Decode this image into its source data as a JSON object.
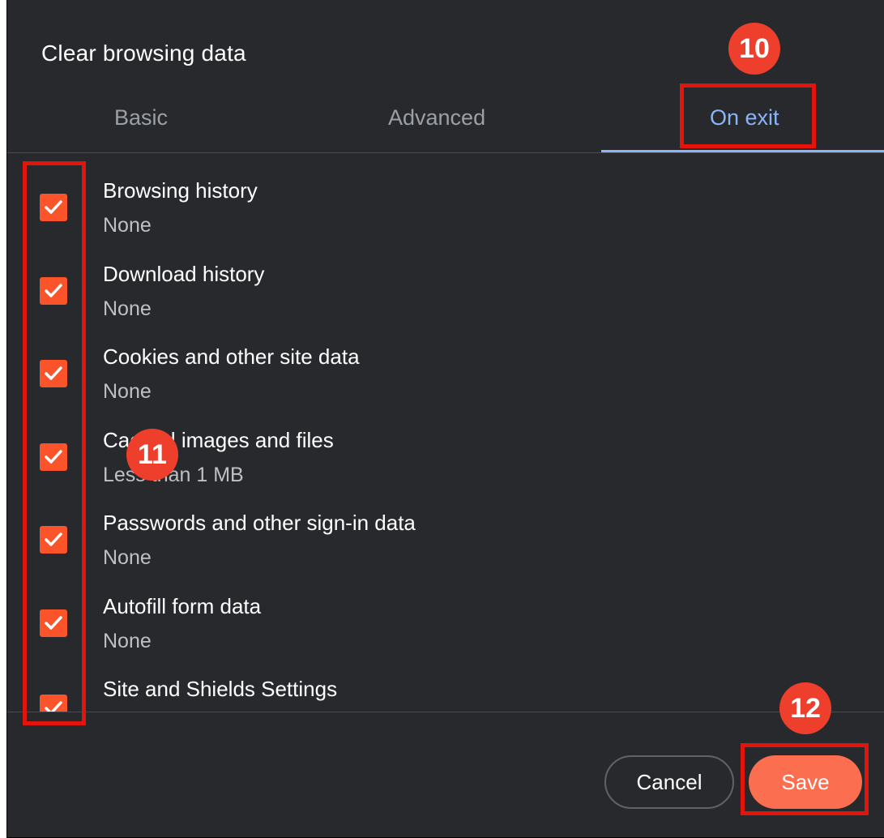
{
  "dialog": {
    "title": "Clear browsing data"
  },
  "tabs": [
    {
      "label": "Basic"
    },
    {
      "label": "Advanced"
    },
    {
      "label": "On exit"
    }
  ],
  "items": [
    {
      "title": "Browsing history",
      "subtitle": "None",
      "checked": true
    },
    {
      "title": "Download history",
      "subtitle": "None",
      "checked": true
    },
    {
      "title": "Cookies and other site data",
      "subtitle": "None",
      "checked": true
    },
    {
      "title": "Cached images and files",
      "subtitle": "Less than 1 MB",
      "checked": true
    },
    {
      "title": "Passwords and other sign-in data",
      "subtitle": "None",
      "checked": true
    },
    {
      "title": "Autofill form data",
      "subtitle": "None",
      "checked": true
    },
    {
      "title": "Site and Shields Settings",
      "subtitle": "",
      "checked": true
    }
  ],
  "buttons": {
    "cancel": "Cancel",
    "save": "Save"
  },
  "annotations": {
    "step10": "10",
    "step11": "11",
    "step12": "12"
  },
  "colors": {
    "accent": "#fb542b",
    "tab_active": "#8ab4f8",
    "annotation": "#e3140c",
    "save": "#fb6f50"
  }
}
